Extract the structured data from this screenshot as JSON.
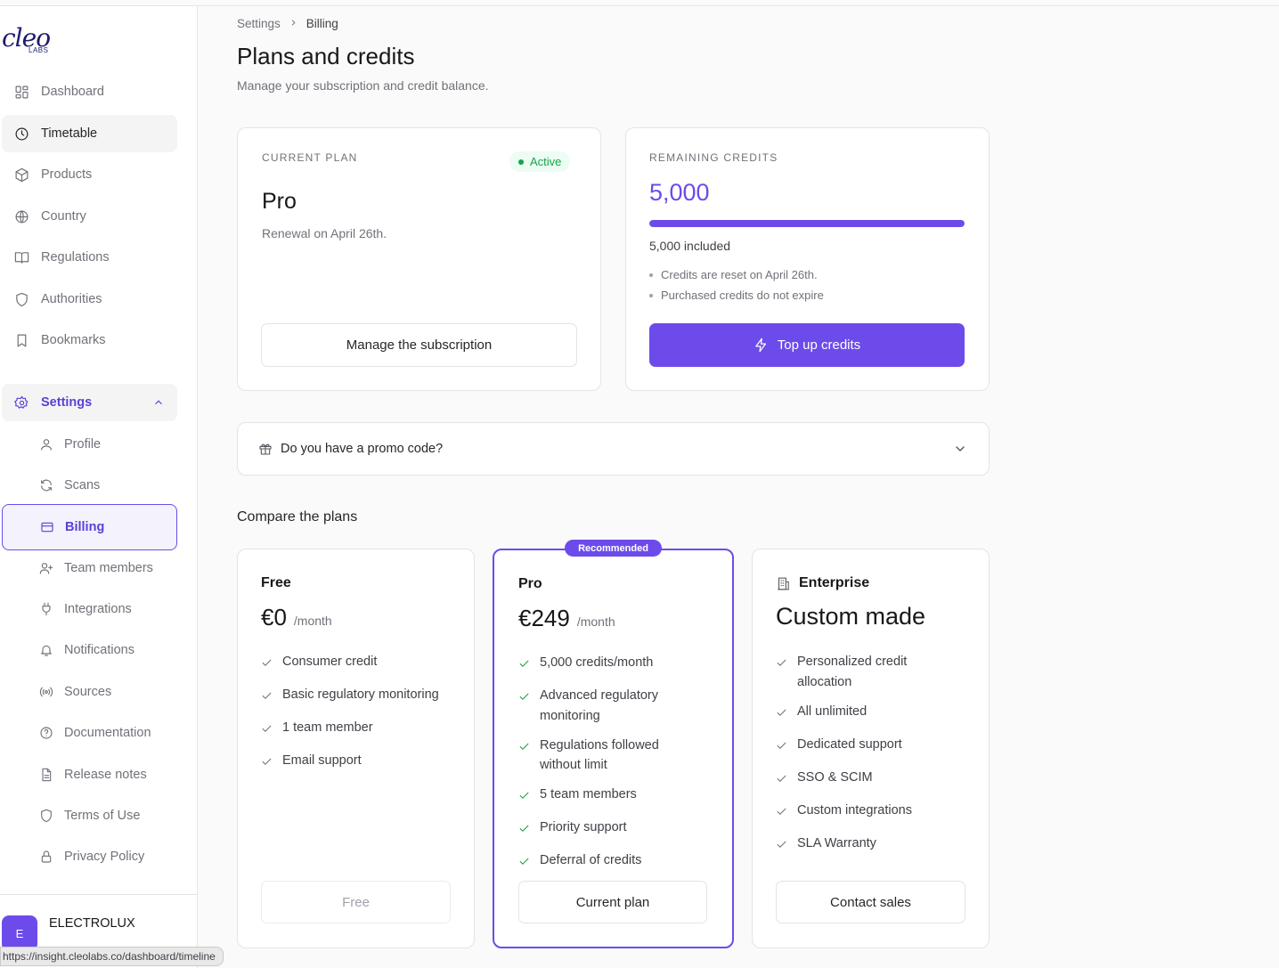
{
  "logo": {
    "word": "cleo",
    "sub": "LABS"
  },
  "sidebar": {
    "items": [
      {
        "label": "Dashboard",
        "icon": "dashboard-icon"
      },
      {
        "label": "Timetable",
        "icon": "clock-icon"
      },
      {
        "label": "Products",
        "icon": "package-icon"
      },
      {
        "label": "Country",
        "icon": "globe-icon"
      },
      {
        "label": "Regulations",
        "icon": "book-icon"
      },
      {
        "label": "Authorities",
        "icon": "shield-icon"
      },
      {
        "label": "Bookmarks",
        "icon": "bookmark-icon"
      }
    ],
    "settings": {
      "label": "Settings",
      "icon": "gear-icon"
    },
    "sub_items": [
      {
        "label": "Profile",
        "icon": "user-icon"
      },
      {
        "label": "Scans",
        "icon": "refresh-icon"
      },
      {
        "label": "Billing",
        "icon": "credit-card-icon"
      },
      {
        "label": "Team members",
        "icon": "user-plus-icon"
      },
      {
        "label": "Integrations",
        "icon": "plug-icon"
      },
      {
        "label": "Notifications",
        "icon": "bell-icon"
      },
      {
        "label": "Sources",
        "icon": "broadcast-icon"
      },
      {
        "label": "Documentation",
        "icon": "help-circle-icon"
      },
      {
        "label": "Release notes",
        "icon": "file-text-icon"
      },
      {
        "label": "Terms of Use",
        "icon": "shield-icon"
      },
      {
        "label": "Privacy Policy",
        "icon": "lock-icon"
      }
    ],
    "org": {
      "initial": "E",
      "name": "ELECTROLUX"
    }
  },
  "status_url": "https://insight.cleolabs.co/dashboard/timeline",
  "breadcrumb": {
    "parent": "Settings",
    "current": "Billing"
  },
  "page": {
    "title": "Plans and credits",
    "subtitle": "Manage your subscription and credit balance."
  },
  "current_plan": {
    "label": "CURRENT PLAN",
    "status": "Active",
    "name": "Pro",
    "renewal": "Renewal on April 26th.",
    "button": "Manage the subscription"
  },
  "credits": {
    "label": "REMAINING CREDITS",
    "value": "5,000",
    "progress_fraction": 1.0,
    "included": "5,000 included",
    "notes": [
      "Credits are reset on April 26th.",
      "Purchased credits do not expire"
    ],
    "button": "Top up credits"
  },
  "promo": {
    "text": "Do you have a promo code?"
  },
  "compare": {
    "title": "Compare the plans",
    "recommended": "Recommended",
    "plans": [
      {
        "name": "Free",
        "price": "€0",
        "per": "/month",
        "features": [
          "Consumer credit",
          "Basic regulatory monitoring",
          "1 team member",
          "Email support"
        ],
        "button": "Free"
      },
      {
        "name": "Pro",
        "price": "€249",
        "per": "/month",
        "features": [
          "5,000 credits/month",
          "Advanced regulatory monitoring",
          "Regulations followed without limit",
          "5 team members",
          "Priority support",
          "Deferral of credits"
        ],
        "button": "Current plan"
      },
      {
        "name": "Enterprise",
        "price": "Custom made",
        "features": [
          "Personalized credit allocation",
          "All unlimited",
          "Dedicated support",
          "SSO & SCIM",
          "Custom integrations",
          "SLA Warranty"
        ],
        "button": "Contact sales"
      }
    ]
  },
  "colors": {
    "accent": "#6d4bea",
    "success": "#16a34a"
  }
}
